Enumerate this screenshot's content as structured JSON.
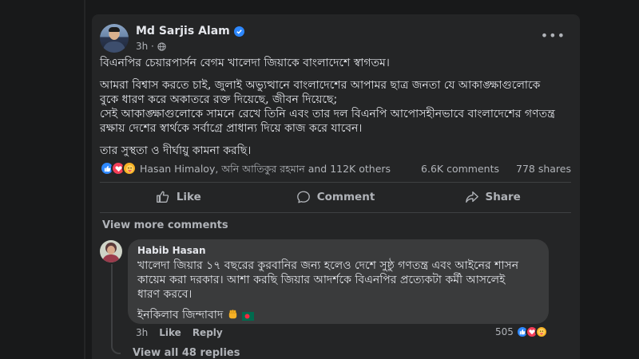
{
  "post": {
    "author": "Md Sarjis Alam",
    "time": "3h ·",
    "more": "•••",
    "paragraphs": [
      "বিএনপির চেয়ারপার্সন বেগম খালেদা জিয়াকে বাংলাদেশে স্বাগতম।",
      "আমরা বিশ্বাস করতে চাই, জুলাই অভ্যুত্থানে বাংলাদেশের আপামর ছাত্র জনতা যে আকাঙ্ক্ষাগুলোকে",
      "বুকে ধারণ করে অকাতরে রক্ত দিয়েছে, জীবন দিয়েছে;",
      "সেই আকাঙ্ক্ষাগুলোকে সামনে রেখে তিনি এবং তার দল বিএনপি আপোসহীনভাবে বাংলাদেশের গণতন্ত্র",
      "রক্ষায় দেশের স্বার্থকে সর্বাগ্রে প্রাধান্য দিয়ে কাজ করে যাবেন।",
      "তার সুস্থতা ও দীর্ঘায়ু কামনা করছি।"
    ],
    "reaction_names": "Hasan Himaloy, অনি আতিকুর রহমান and 112K others",
    "comments_count": "6.6K comments",
    "shares_count": "778 shares",
    "like_label": "Like",
    "comment_label": "Comment",
    "share_label": "Share",
    "view_more_comments": "View more comments"
  },
  "comment": {
    "author": "Habib Hasan",
    "lines": [
      "খালেদা জিয়ার ১৭ বছরের কুরবানির জন্য হলেও দেশে সুষ্ঠু গণতন্ত্র এবং আইনের শাসন",
      "কায়েম করা দরকার। আশা করছি জিয়ার আদর্শকে বিএনপির প্রত্যেকটা কর্মী আসলেই",
      "ধারণ করবে।"
    ],
    "slogan": "ইনকিলাব জিন্দাবাদ",
    "time": "3h",
    "like_label": "Like",
    "reply_label": "Reply",
    "reaction_count": "505",
    "view_replies": "View all 48 replies"
  },
  "colors": {
    "background": "#18191a",
    "card": "#242526",
    "bubble": "#3a3b3c",
    "accent": "#2d88ff"
  },
  "icons": [
    "verified-badge-icon",
    "globe-icon",
    "more-options-icon",
    "like-icon",
    "comment-icon",
    "share-icon",
    "like-reaction-icon",
    "love-reaction-icon",
    "care-reaction-icon",
    "raised-fist-emoji",
    "bangladesh-flag-emoji"
  ]
}
